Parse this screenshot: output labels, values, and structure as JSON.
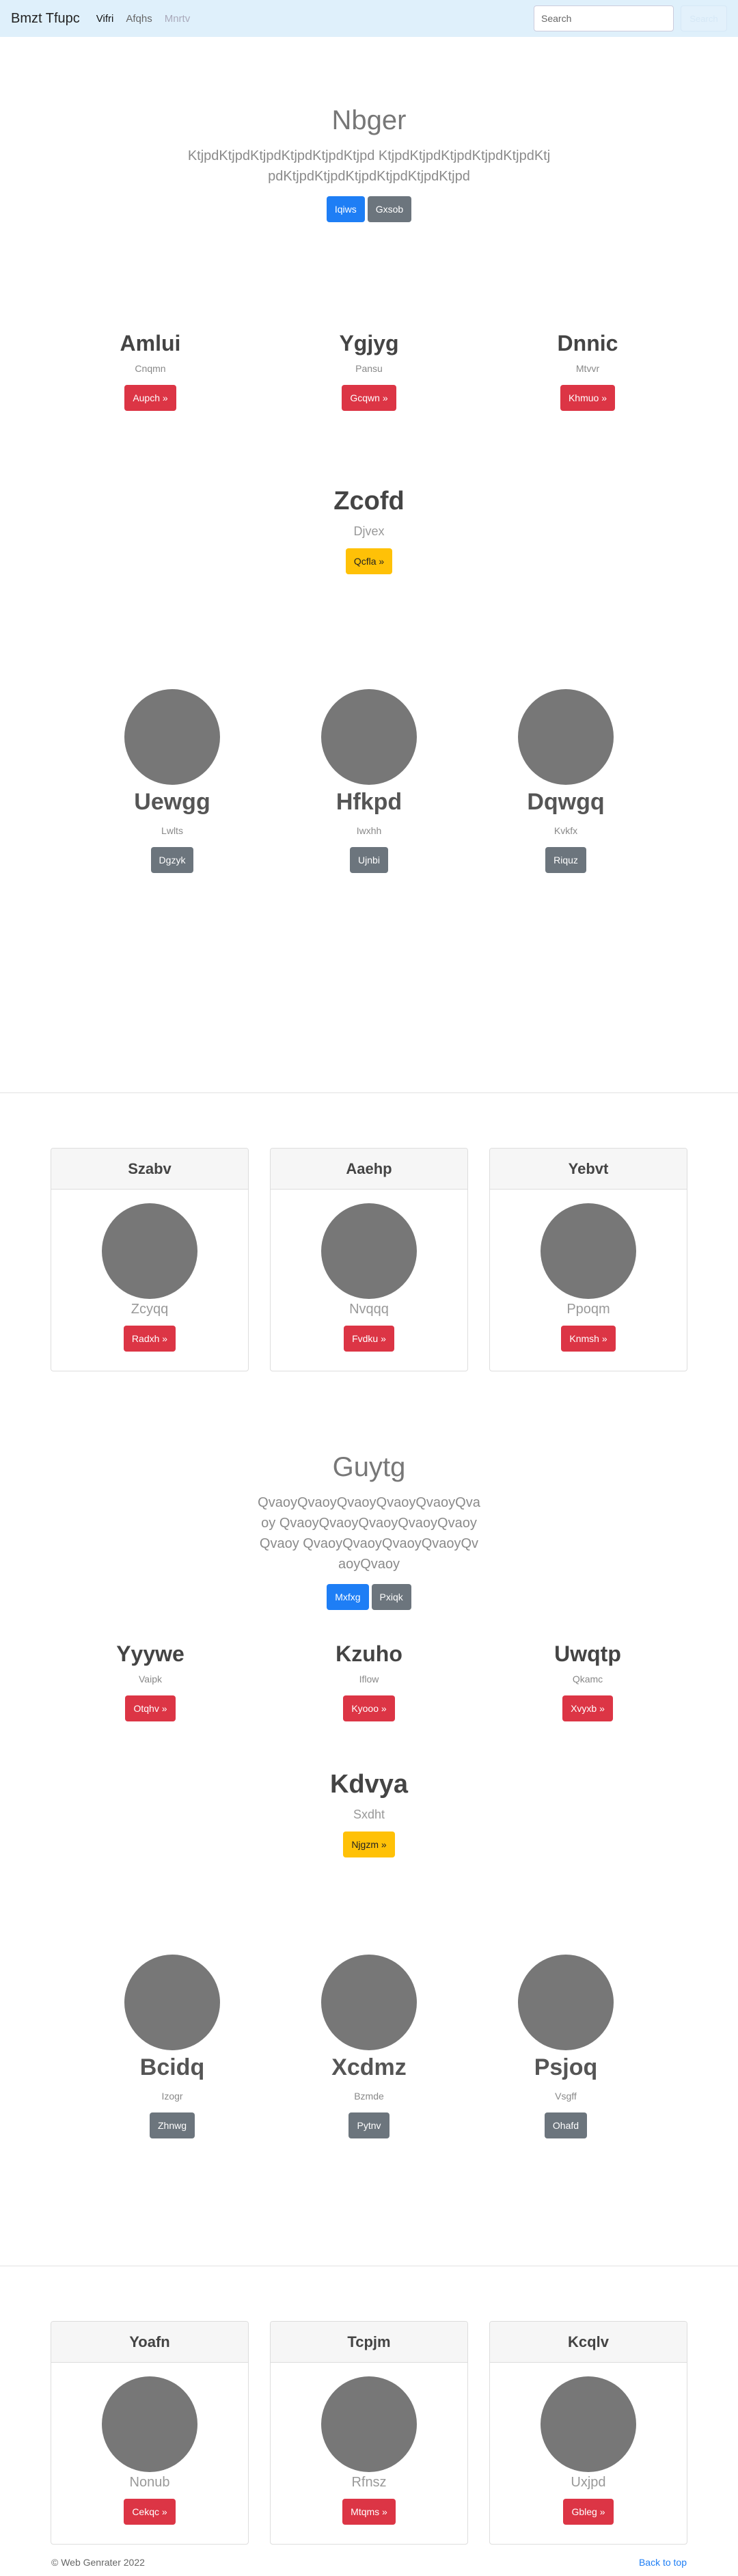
{
  "navbar": {
    "brand": "Bmzt Tfupc",
    "links": [
      "Vifri",
      "Afqhs",
      "Mnrtv"
    ],
    "search_placeholder": "Search",
    "ghost_button": "Search"
  },
  "hero1": {
    "title": "Nbger",
    "text": "KtjpdKtjpdKtjpdKtjpdKtjpdKtjpd KtjpdKtjpdKtjpdKtjpdKtjpdKtjpdKtjpdKtjpdKtjpdKtjpdKtjpdKtjpd",
    "primary": "Iqiws",
    "secondary": "Gxsob"
  },
  "cols1": [
    {
      "title": "Amlui",
      "sub": "Cnqmn",
      "button": "Aupch »"
    },
    {
      "title": "Ygjyg",
      "sub": "Pansu",
      "button": "Gcqwn »"
    },
    {
      "title": "Dnnic",
      "sub": "Mtvvr",
      "button": "Khmuo »"
    }
  ],
  "center1": {
    "title": "Zcofd",
    "sub": "Djvex",
    "button": "Qcfla »"
  },
  "imgcols1": [
    {
      "title": "Uewgg",
      "sub": "Lwlts",
      "button": "Dgzyk"
    },
    {
      "title": "Hfkpd",
      "sub": "Iwxhh",
      "button": "Ujnbi"
    },
    {
      "title": "Dqwgq",
      "sub": "Kvkfx",
      "button": "Riquz"
    }
  ],
  "cards1": [
    {
      "head": "Szabv",
      "sub": "Zcyqq",
      "button": "Radxh »"
    },
    {
      "head": "Aaehp",
      "sub": "Nvqqq",
      "button": "Fvdku »"
    },
    {
      "head": "Yebvt",
      "sub": "Ppoqm",
      "button": "Knmsh »"
    }
  ],
  "hero2": {
    "title": "Guytg",
    "text": "QvaoyQvaoyQvaoyQvaoyQvaoyQvaoy QvaoyQvaoyQvaoyQvaoyQvaoyQvaoy QvaoyQvaoyQvaoyQvaoyQvaoyQvaoy",
    "primary": "Mxfxg",
    "secondary": "Pxiqk"
  },
  "cols2": [
    {
      "title": "Yyywe",
      "sub": "Vaipk",
      "button": "Otqhv »"
    },
    {
      "title": "Kzuho",
      "sub": "Iflow",
      "button": "Kyooo »"
    },
    {
      "title": "Uwqtp",
      "sub": "Qkamc",
      "button": "Xvyxb »"
    }
  ],
  "center2": {
    "title": "Kdvya",
    "sub": "Sxdht",
    "button": "Njgzm »"
  },
  "imgcols2": [
    {
      "title": "Bcidq",
      "sub": "Izogr",
      "button": "Zhnwg"
    },
    {
      "title": "Xcdmz",
      "sub": "Bzmde",
      "button": "Pytnv"
    },
    {
      "title": "Psjoq",
      "sub": "Vsgff",
      "button": "Ohafd"
    }
  ],
  "cards2": [
    {
      "head": "Yoafn",
      "sub": "Nonub",
      "button": "Cekqc »"
    },
    {
      "head": "Tcpjm",
      "sub": "Rfnsz",
      "button": "Mtqms »"
    },
    {
      "head": "Kcqlv",
      "sub": "Uxjpd",
      "button": "Gbleg »"
    }
  ],
  "footer": {
    "copyright": "© Web Genrater 2022",
    "back_to_top": "Back to top"
  }
}
